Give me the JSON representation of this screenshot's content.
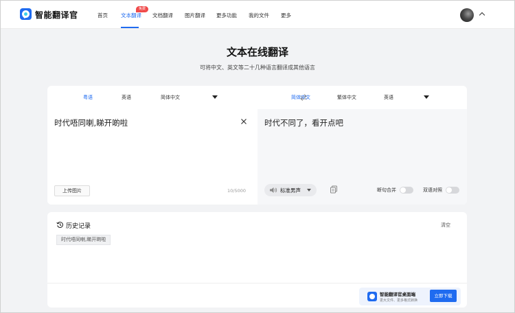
{
  "nav": {
    "brand": "智能翻译官",
    "items": [
      "首页",
      "文本翻译",
      "文档翻译",
      "图片翻译",
      "更多功能",
      "我的文件",
      "更多"
    ],
    "active_index": 1,
    "badge": "免费"
  },
  "hero": {
    "title": "文本在线翻译",
    "subtitle": "可将中文、英文等二十几种语言翻译成其他语言"
  },
  "translator": {
    "source_langs": [
      "粤语",
      "英语",
      "简体中文"
    ],
    "source_active": 0,
    "target_langs": [
      "简体中文",
      "繁体中文",
      "英语"
    ],
    "target_active": 0,
    "source_text": "时代唔同喇,睇开啲啦",
    "target_text": "时代不同了，看开点吧",
    "upload_label": "上传图片",
    "char_count": "10/5000",
    "voice": "标准男声",
    "toggle_merge": "断句合并",
    "toggle_bilingual": "双语对照",
    "toggle_merge_on": false,
    "toggle_bilingual_on": false
  },
  "history": {
    "title": "历史记录",
    "clear_label": "清空",
    "items": [
      "时代唔同喇,睇开啲啦"
    ]
  },
  "promo": {
    "title": "智能翻译官桌面端",
    "subtitle": "更大文件、更多格式转换",
    "button": "立即下载"
  },
  "colors": {
    "accent": "#1f6bf0",
    "badge": "#f04a4a"
  }
}
